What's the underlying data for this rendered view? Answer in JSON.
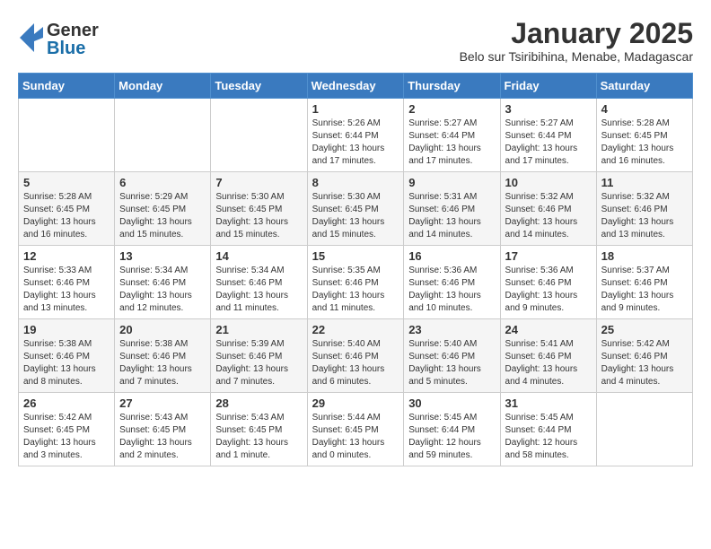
{
  "header": {
    "logo_line1": "General",
    "logo_line2": "Blue",
    "month": "January 2025",
    "location": "Belo sur Tsiribihina, Menabe, Madagascar"
  },
  "days_of_week": [
    "Sunday",
    "Monday",
    "Tuesday",
    "Wednesday",
    "Thursday",
    "Friday",
    "Saturday"
  ],
  "weeks": [
    [
      {
        "day": "",
        "text": ""
      },
      {
        "day": "",
        "text": ""
      },
      {
        "day": "",
        "text": ""
      },
      {
        "day": "1",
        "text": "Sunrise: 5:26 AM\nSunset: 6:44 PM\nDaylight: 13 hours\nand 17 minutes."
      },
      {
        "day": "2",
        "text": "Sunrise: 5:27 AM\nSunset: 6:44 PM\nDaylight: 13 hours\nand 17 minutes."
      },
      {
        "day": "3",
        "text": "Sunrise: 5:27 AM\nSunset: 6:44 PM\nDaylight: 13 hours\nand 17 minutes."
      },
      {
        "day": "4",
        "text": "Sunrise: 5:28 AM\nSunset: 6:45 PM\nDaylight: 13 hours\nand 16 minutes."
      }
    ],
    [
      {
        "day": "5",
        "text": "Sunrise: 5:28 AM\nSunset: 6:45 PM\nDaylight: 13 hours\nand 16 minutes."
      },
      {
        "day": "6",
        "text": "Sunrise: 5:29 AM\nSunset: 6:45 PM\nDaylight: 13 hours\nand 15 minutes."
      },
      {
        "day": "7",
        "text": "Sunrise: 5:30 AM\nSunset: 6:45 PM\nDaylight: 13 hours\nand 15 minutes."
      },
      {
        "day": "8",
        "text": "Sunrise: 5:30 AM\nSunset: 6:45 PM\nDaylight: 13 hours\nand 15 minutes."
      },
      {
        "day": "9",
        "text": "Sunrise: 5:31 AM\nSunset: 6:46 PM\nDaylight: 13 hours\nand 14 minutes."
      },
      {
        "day": "10",
        "text": "Sunrise: 5:32 AM\nSunset: 6:46 PM\nDaylight: 13 hours\nand 14 minutes."
      },
      {
        "day": "11",
        "text": "Sunrise: 5:32 AM\nSunset: 6:46 PM\nDaylight: 13 hours\nand 13 minutes."
      }
    ],
    [
      {
        "day": "12",
        "text": "Sunrise: 5:33 AM\nSunset: 6:46 PM\nDaylight: 13 hours\nand 13 minutes."
      },
      {
        "day": "13",
        "text": "Sunrise: 5:34 AM\nSunset: 6:46 PM\nDaylight: 13 hours\nand 12 minutes."
      },
      {
        "day": "14",
        "text": "Sunrise: 5:34 AM\nSunset: 6:46 PM\nDaylight: 13 hours\nand 11 minutes."
      },
      {
        "day": "15",
        "text": "Sunrise: 5:35 AM\nSunset: 6:46 PM\nDaylight: 13 hours\nand 11 minutes."
      },
      {
        "day": "16",
        "text": "Sunrise: 5:36 AM\nSunset: 6:46 PM\nDaylight: 13 hours\nand 10 minutes."
      },
      {
        "day": "17",
        "text": "Sunrise: 5:36 AM\nSunset: 6:46 PM\nDaylight: 13 hours\nand 9 minutes."
      },
      {
        "day": "18",
        "text": "Sunrise: 5:37 AM\nSunset: 6:46 PM\nDaylight: 13 hours\nand 9 minutes."
      }
    ],
    [
      {
        "day": "19",
        "text": "Sunrise: 5:38 AM\nSunset: 6:46 PM\nDaylight: 13 hours\nand 8 minutes."
      },
      {
        "day": "20",
        "text": "Sunrise: 5:38 AM\nSunset: 6:46 PM\nDaylight: 13 hours\nand 7 minutes."
      },
      {
        "day": "21",
        "text": "Sunrise: 5:39 AM\nSunset: 6:46 PM\nDaylight: 13 hours\nand 7 minutes."
      },
      {
        "day": "22",
        "text": "Sunrise: 5:40 AM\nSunset: 6:46 PM\nDaylight: 13 hours\nand 6 minutes."
      },
      {
        "day": "23",
        "text": "Sunrise: 5:40 AM\nSunset: 6:46 PM\nDaylight: 13 hours\nand 5 minutes."
      },
      {
        "day": "24",
        "text": "Sunrise: 5:41 AM\nSunset: 6:46 PM\nDaylight: 13 hours\nand 4 minutes."
      },
      {
        "day": "25",
        "text": "Sunrise: 5:42 AM\nSunset: 6:46 PM\nDaylight: 13 hours\nand 4 minutes."
      }
    ],
    [
      {
        "day": "26",
        "text": "Sunrise: 5:42 AM\nSunset: 6:45 PM\nDaylight: 13 hours\nand 3 minutes."
      },
      {
        "day": "27",
        "text": "Sunrise: 5:43 AM\nSunset: 6:45 PM\nDaylight: 13 hours\nand 2 minutes."
      },
      {
        "day": "28",
        "text": "Sunrise: 5:43 AM\nSunset: 6:45 PM\nDaylight: 13 hours\nand 1 minute."
      },
      {
        "day": "29",
        "text": "Sunrise: 5:44 AM\nSunset: 6:45 PM\nDaylight: 13 hours\nand 0 minutes."
      },
      {
        "day": "30",
        "text": "Sunrise: 5:45 AM\nSunset: 6:44 PM\nDaylight: 12 hours\nand 59 minutes."
      },
      {
        "day": "31",
        "text": "Sunrise: 5:45 AM\nSunset: 6:44 PM\nDaylight: 12 hours\nand 58 minutes."
      },
      {
        "day": "",
        "text": ""
      }
    ]
  ]
}
